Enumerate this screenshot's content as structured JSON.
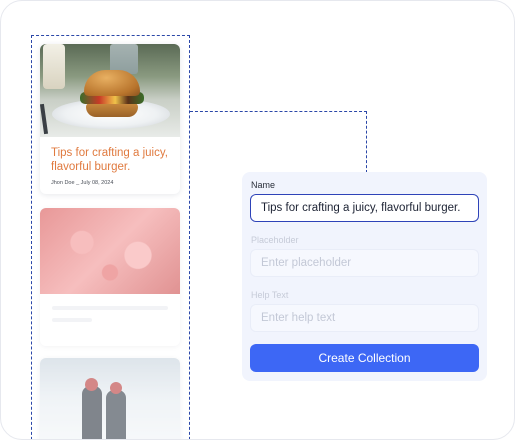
{
  "cards": [
    {
      "title": "Tips for crafting a juicy, flavorful burger.",
      "meta": "Jhon Doe _ July 08, 2024",
      "image_icon": "burger-photo"
    },
    {
      "image_icon": "red-object-photo"
    },
    {
      "image_icon": "snow-people-photo"
    }
  ],
  "form": {
    "name_label": "Name",
    "name_value": "Tips for crafting a juicy, flavorful burger.",
    "placeholder_label": "Placeholder",
    "placeholder_placeholder": "Enter placeholder",
    "help_label": "Help Text",
    "help_placeholder": "Enter help text",
    "submit_label": "Create Collection"
  },
  "colors": {
    "accent": "#3d67f5",
    "title_orange": "#e07a3f",
    "dashed": "#2b47a8",
    "panel_bg": "#f1f4fd"
  }
}
